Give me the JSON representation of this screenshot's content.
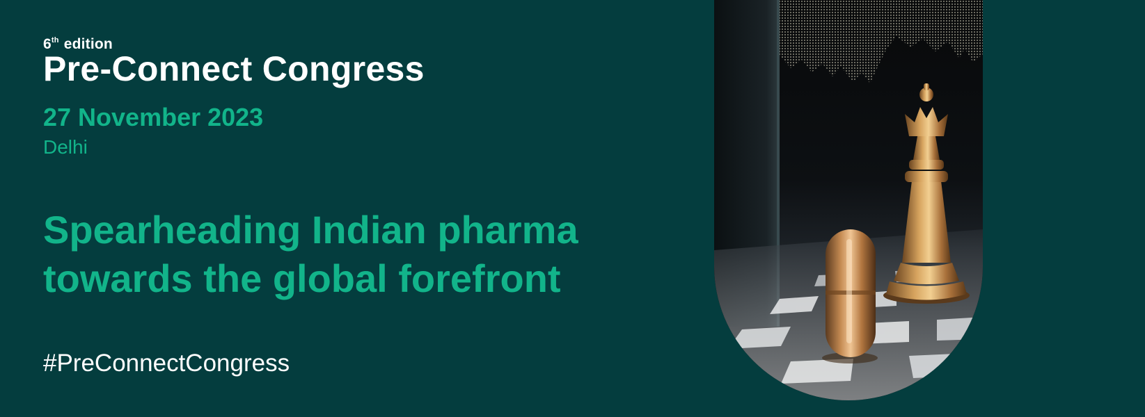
{
  "banner": {
    "edition_number": "6",
    "edition_suffix": "th",
    "edition_word": "edition",
    "title": "Pre-Connect Congress",
    "date": "27 November 2023",
    "city": "Delhi",
    "tagline_line1": "Spearheading Indian pharma",
    "tagline_line2": "towards the global forefront",
    "hashtag": "#PreConnectCongress"
  },
  "image": {
    "subject": "chess-board-with-gold-queen-and-capsule",
    "icons": [
      "chess-queen-icon",
      "capsule-icon"
    ]
  },
  "colors": {
    "background": "#043d3e",
    "accent": "#12b48a",
    "text": "#ffffff",
    "gold": "#c9924a"
  }
}
